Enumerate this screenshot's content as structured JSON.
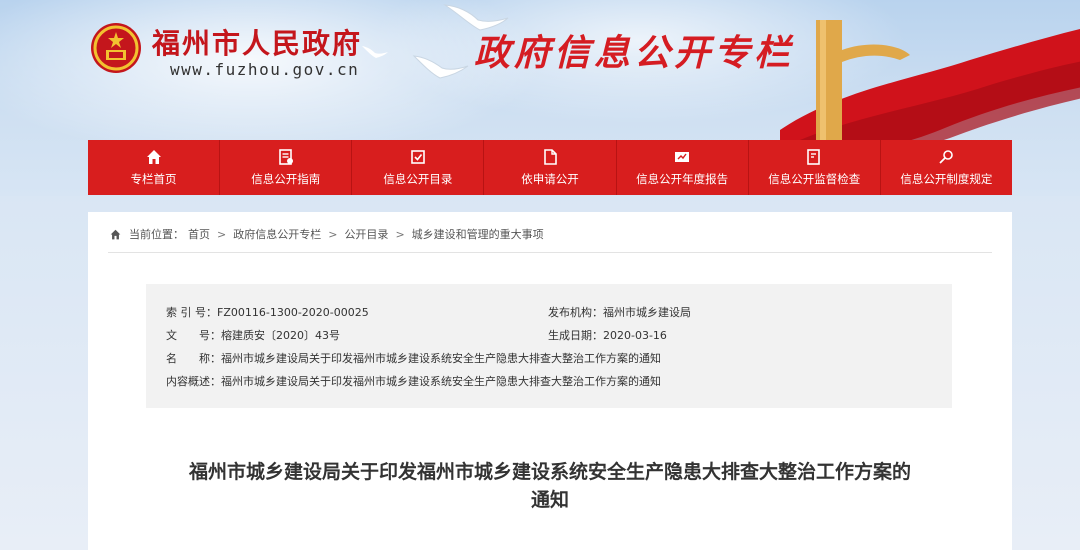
{
  "header": {
    "site_name": "福州市人民政府",
    "site_url": "www.fuzhou.gov.cn",
    "column_title": "政府信息公开专栏"
  },
  "nav": {
    "items": [
      {
        "label": "专栏首页",
        "icon": "home-icon"
      },
      {
        "label": "信息公开指南",
        "icon": "guide-icon"
      },
      {
        "label": "信息公开目录",
        "icon": "catalog-icon"
      },
      {
        "label": "依申请公开",
        "icon": "document-icon"
      },
      {
        "label": "信息公开年度报告",
        "icon": "report-icon"
      },
      {
        "label": "信息公开监督检查",
        "icon": "inspection-icon"
      },
      {
        "label": "信息公开制度规定",
        "icon": "regulation-icon"
      }
    ]
  },
  "breadcrumb": {
    "prefix": "当前位置：",
    "items": [
      "首页",
      "政府信息公开专栏",
      "公开目录",
      "城乡建设和管理的重大事项"
    ],
    "separator": ">"
  },
  "meta": {
    "index_label": "索 引 号：",
    "index_value": "FZ00116-1300-2020-00025",
    "publisher_label": "发布机构：",
    "publisher_value": "福州市城乡建设局",
    "docno_label": "文　　号：",
    "docno_value": "榕建质安〔2020〕43号",
    "date_label": "生成日期：",
    "date_value": "2020-03-16",
    "name_label": "名　　称：",
    "name_value": "福州市城乡建设局关于印发福州市城乡建设系统安全生产隐患大排查大整治工作方案的通知",
    "summary_label": "内容概述：",
    "summary_value": "福州市城乡建设局关于印发福州市城乡建设系统安全生产隐患大排查大整治工作方案的通知"
  },
  "document": {
    "title_line1": "福州市城乡建设局关于印发福州市城乡建设系统安全生产隐患大排查大整治工作方案的",
    "title_line2": "通知"
  },
  "colors": {
    "nav_red": "#d81e1e",
    "brand_red": "#c4161c",
    "title_red": "#d51c22"
  }
}
